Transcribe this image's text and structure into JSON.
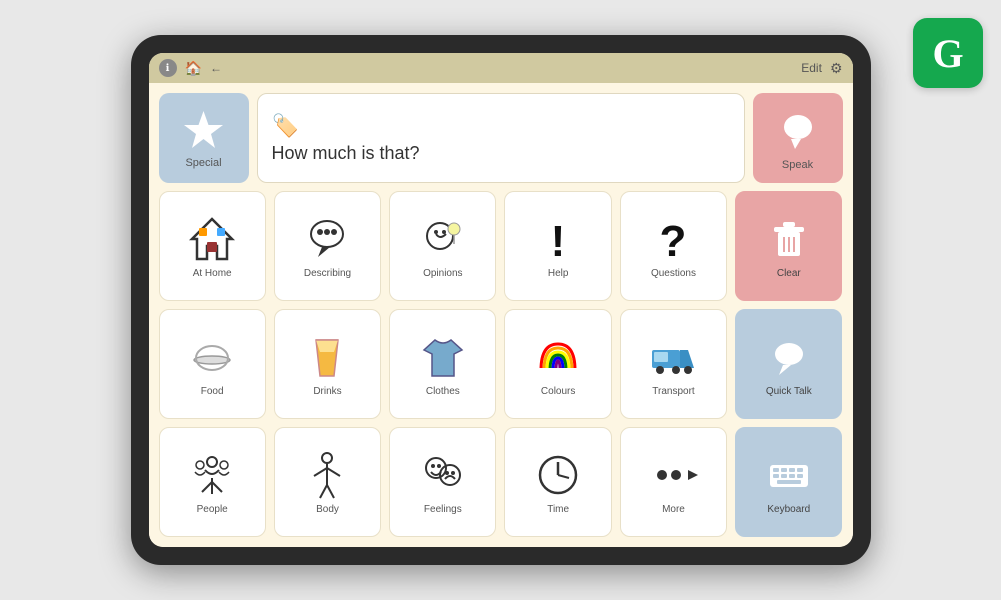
{
  "grammarly": {
    "letter": "G"
  },
  "topbar": {
    "edit_label": "Edit",
    "gear_label": "⚙"
  },
  "special": {
    "label": "Special"
  },
  "speech": {
    "icon": "🏷️",
    "text": "How much is that?"
  },
  "speak": {
    "label": "Speak"
  },
  "clear": {
    "label": "Clear"
  },
  "quicktalk": {
    "label": "Quick Talk"
  },
  "keyboard": {
    "label": "Keyboard"
  },
  "grid": {
    "row1": [
      {
        "label": "At Home",
        "icon": "house"
      },
      {
        "label": "Describing",
        "icon": "speech_bubble"
      },
      {
        "label": "Opinions",
        "icon": "face_think"
      },
      {
        "label": "Help",
        "icon": "exclaim"
      },
      {
        "label": "Questions",
        "icon": "question"
      }
    ],
    "row2": [
      {
        "label": "Food",
        "icon": "plate"
      },
      {
        "label": "Drinks",
        "icon": "glass"
      },
      {
        "label": "Clothes",
        "icon": "tshirt"
      },
      {
        "label": "Colours",
        "icon": "rainbow"
      },
      {
        "label": "Transport",
        "icon": "truck"
      }
    ],
    "row3": [
      {
        "label": "People",
        "icon": "people"
      },
      {
        "label": "Body",
        "icon": "body"
      },
      {
        "label": "Feelings",
        "icon": "feelings"
      },
      {
        "label": "Time",
        "icon": "clock"
      },
      {
        "label": "More",
        "icon": "more"
      }
    ]
  }
}
